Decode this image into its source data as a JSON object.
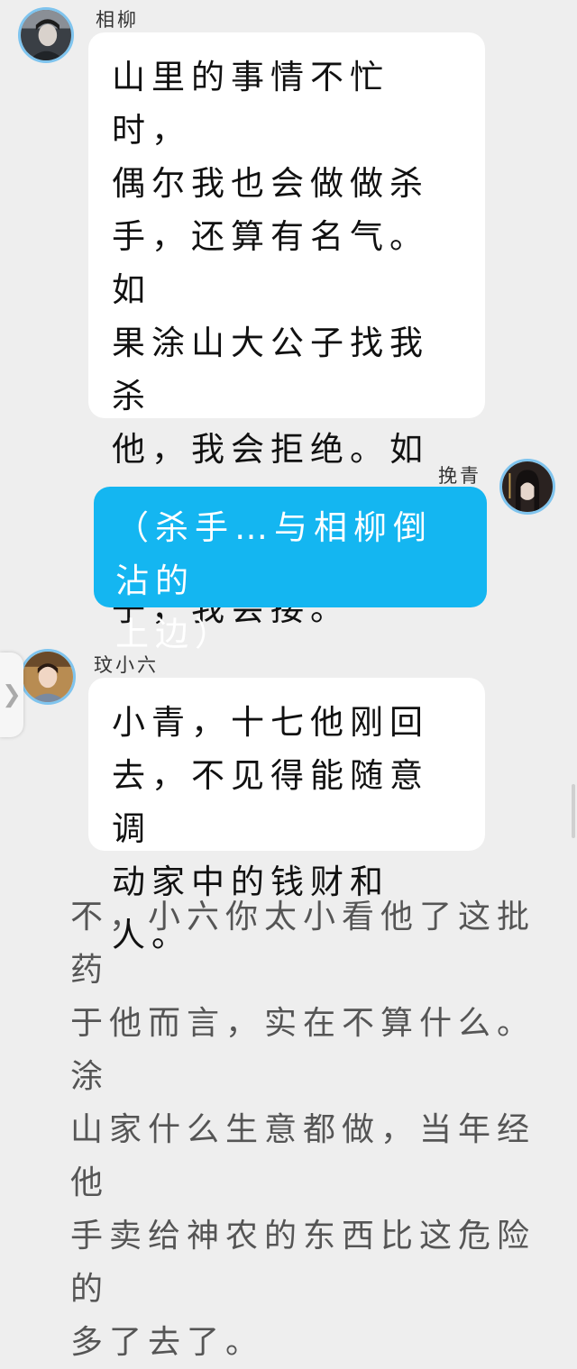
{
  "messages": [
    {
      "sender": "相柳",
      "side": "left",
      "text": "山里的事情不忙时，\n偶尔我也会做做杀\n手，还算有名气。如\n果涂山大公子找我杀\n他，我会拒绝。如果\n他考虑杀涂山大公\n子，我会接。"
    },
    {
      "sender": "挽青",
      "side": "right",
      "text": "（杀手…与相柳倒沾的\n上边）"
    },
    {
      "sender": "玟小六",
      "side": "left",
      "text": "小青，十七他刚回\n去，不见得能随意调\n动家中的钱财和人。"
    }
  ],
  "narration": "不，小六你太小看他了这批药\n于他而言，实在不算什么。涂\n山家什么生意都做，当年经他\n手卖给神农的东西比这危险的\n多了去了。",
  "side_handle_icon": "chevron-right-icon",
  "colors": {
    "background": "#eeeeee",
    "bubble_left": "#ffffff",
    "bubble_right": "#14b6f1",
    "avatar_ring": "#7fc4ee"
  }
}
